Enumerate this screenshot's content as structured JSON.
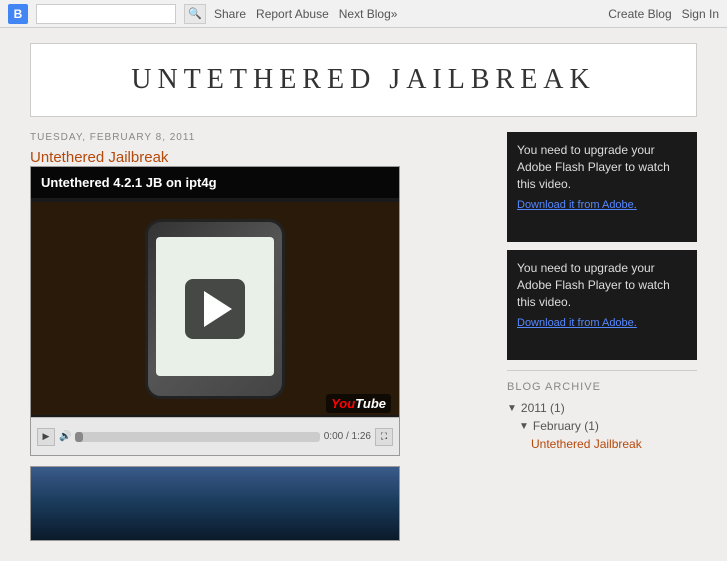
{
  "topbar": {
    "logo_text": "B",
    "search_placeholder": "",
    "search_icon": "🔍",
    "links": [
      "Share",
      "Report Abuse",
      "Next Blog»"
    ],
    "right_links": [
      "Create Blog",
      "Sign In"
    ]
  },
  "blog": {
    "title": "UNTETHERED JAILBREAK"
  },
  "post": {
    "date": "TUESDAY, FEBRUARY 8, 2011",
    "title": "Untethered Jailbreak",
    "video_title": "Untethered 4.2.1 JB on ipt4g",
    "youtube_label": "You",
    "youtube_label2": "Tube",
    "time": "0:00 / 1:26"
  },
  "sidebar": {
    "flash_text1": "You need to upgrade your Adobe Flash Player to watch this video.",
    "flash_link1": "Download it from Adobe.",
    "flash_text2": "You need to upgrade your Adobe Flash Player to watch this video.",
    "flash_link2": "Download it from Adobe.",
    "archive_title": "BLOG ARCHIVE",
    "archive_year": "2011 (1)",
    "archive_month": "February (1)",
    "archive_post": "Untethered Jailbreak"
  }
}
